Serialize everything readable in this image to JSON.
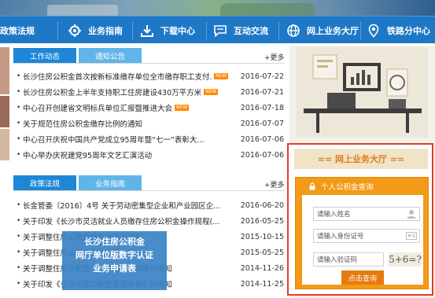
{
  "nav": {
    "items": [
      {
        "label": "政策法规",
        "icon": "policy-icon"
      },
      {
        "label": "业务指南",
        "icon": "gear-icon"
      },
      {
        "label": "下载中心",
        "icon": "download-icon"
      },
      {
        "label": "互动交流",
        "icon": "chat-icon"
      },
      {
        "label": "网上业务大厅",
        "icon": "globe-icon"
      },
      {
        "label": "铁路分中心",
        "icon": "location-icon"
      }
    ]
  },
  "section1": {
    "tabs": [
      "工作动态",
      "通知公告"
    ],
    "more": "+更多",
    "items": [
      {
        "title": "长沙住房公积金首次按新标准缴存单位全市缴存职工支付...",
        "date": "2016-07-22",
        "badge": "NEW"
      },
      {
        "title": "长沙住房公积金上半年支持职工住房建设430万平方米",
        "date": "2016-07-21",
        "badge": "NEW"
      },
      {
        "title": "中心召开创建省文明标兵单位汇报暨推进大会",
        "date": "2016-07-18",
        "badge": "NEW"
      },
      {
        "title": "关于规范住房公积金缴存比例的通知",
        "date": "2016-07-07",
        "badge": ""
      },
      {
        "title": "中心召开庆祝中国共产党成立95周年暨“七一”表彰大...",
        "date": "2016-07-06",
        "badge": ""
      },
      {
        "title": "中心举办庆祝建党95周年文艺汇演活动",
        "date": "2016-07-06",
        "badge": ""
      }
    ]
  },
  "section2": {
    "tabs": [
      "政策法规",
      "业务指南"
    ],
    "more": "+更多",
    "items": [
      {
        "title": "长金管委〔2016〕4号 关于劳动密集型企业和产业园区企...",
        "date": "2016-06-20"
      },
      {
        "title": "关于印发《长沙市灵活就业人员缴存住房公积金操作规程(...",
        "date": "2016-05-25"
      },
      {
        "title": "关于调整住房公积金缴存比例的通知",
        "date": "2015-10-15"
      },
      {
        "title": "关于调整住房公积金贷款利率的通知",
        "date": "2015-05-25"
      },
      {
        "title": "关于调整住房公积金个人住房贷款政策的通知",
        "date": "2014-11-26"
      },
      {
        "title": "关于印发《长沙住房公积金管理条例》的通知",
        "date": "2014-11-25"
      }
    ]
  },
  "overlay": {
    "line1": "长沙住房公积金",
    "line2": "网厅单位版数字认证",
    "line3": "业务申请表"
  },
  "hall": {
    "title": "== 网上业务大厅 ==",
    "query_title": "个人公积金查询",
    "name_placeholder": "请输入姓名",
    "id_placeholder": "请输入身份证号",
    "code_placeholder": "请输入验证码",
    "captcha": "5+6=?",
    "submit": "点击查询"
  },
  "colors": {
    "nav_bg": "#1f78c6",
    "tab_active": "#1d86d6",
    "tab_inactive": "#5fb5ea",
    "hall_border": "#e43c2a",
    "query_orange": "#f39a18"
  }
}
